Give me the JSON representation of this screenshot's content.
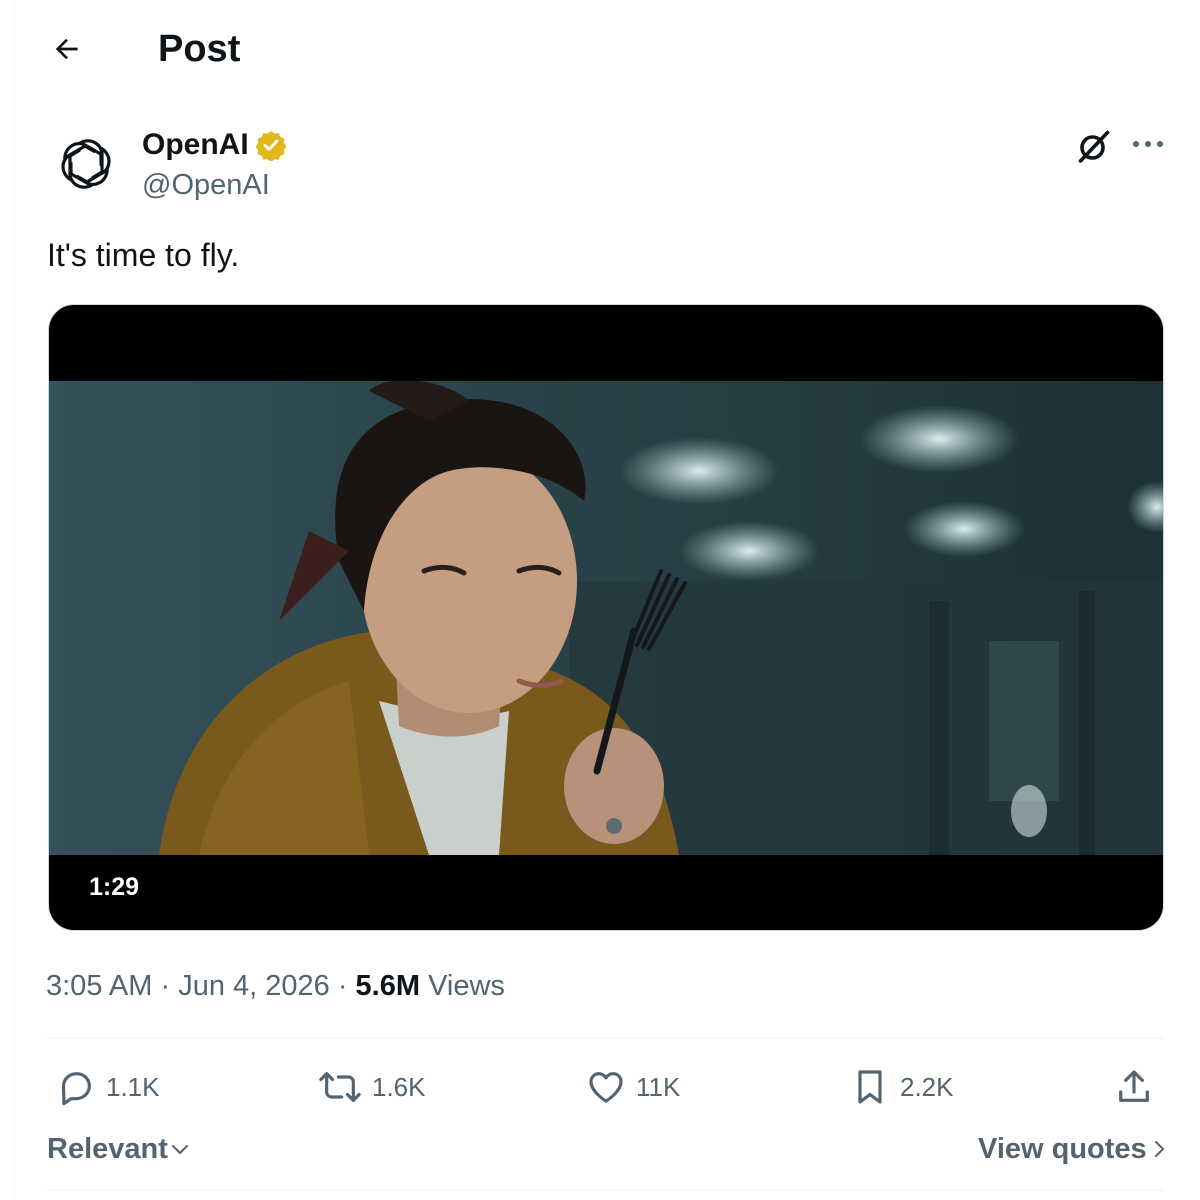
{
  "header": {
    "title": "Post",
    "back_icon": "arrow-left-icon"
  },
  "author": {
    "name": "OpenAI",
    "handle": "@OpenAI",
    "verified": true,
    "badge_color": "#e2b719"
  },
  "post": {
    "text": "It's time to fly.",
    "video_duration": "1:29",
    "time": "3:05 AM",
    "date": "Jun 4, 2026",
    "views_count": "5.6M",
    "views_label": "Views"
  },
  "actions": {
    "replies": "1.1K",
    "reposts": "1.6K",
    "likes": "11K",
    "bookmarks": "2.2K"
  },
  "footer": {
    "sort_label": "Relevant",
    "quotes_label": "View quotes"
  },
  "colors": {
    "text": "#0f1419",
    "secondary": "#536471",
    "divider": "#eff3f4"
  }
}
